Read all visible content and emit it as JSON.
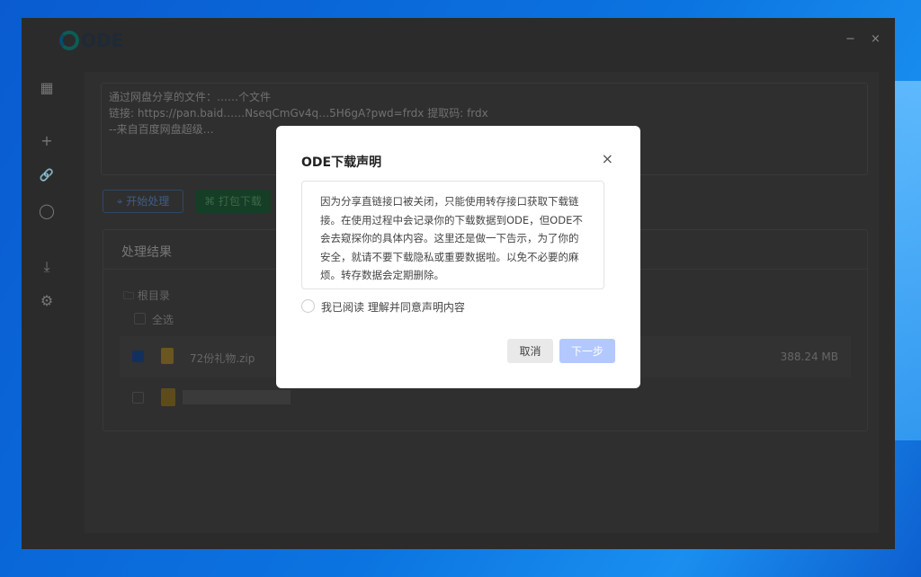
{
  "app": {
    "logo": "ODE",
    "min": "−",
    "close": "×"
  },
  "sidebar": {
    "items": [
      {
        "icon": "grid-icon",
        "glyph": "▦"
      },
      {
        "icon": "plus-icon",
        "glyph": "+"
      },
      {
        "icon": "link-icon",
        "glyph": "🔗"
      },
      {
        "icon": "user-icon",
        "glyph": "◯"
      },
      {
        "icon": "download-icon",
        "glyph": "⤓"
      },
      {
        "icon": "gear-icon",
        "glyph": "⚙"
      }
    ]
  },
  "input": {
    "lines": [
      "通过网盘分享的文件：……个文件",
      "链接: https://pan.baid……NseqCmGv4q…5H6gA?pwd=frdx 提取码: frdx",
      "--来自百度网盘超级…"
    ]
  },
  "toolbar": {
    "start": "⌖ 开始处理",
    "pack": "⌘ 打包下载"
  },
  "results": {
    "title": "处理结果",
    "root": "🗀 根目录",
    "select_all": "全选",
    "files": [
      {
        "name": "72份礼物.zip",
        "size": "388.24 MB",
        "checked": true
      }
    ]
  },
  "dialog": {
    "title": "ODE下载声明",
    "close": "×",
    "body": "因为分享直链接口被关闭，只能使用转存接口获取下载链接。在使用过程中会记录你的下载数据到ODE，但ODE不会去窥探你的具体内容。这里还是做一下告示，为了你的安全，就请不要下载隐私或重要数据啦。以免不必要的麻烦。转存数据会定期删除。",
    "agree": "我已阅读 理解并同意声明内容",
    "cancel": "取消",
    "next": "下一步"
  }
}
